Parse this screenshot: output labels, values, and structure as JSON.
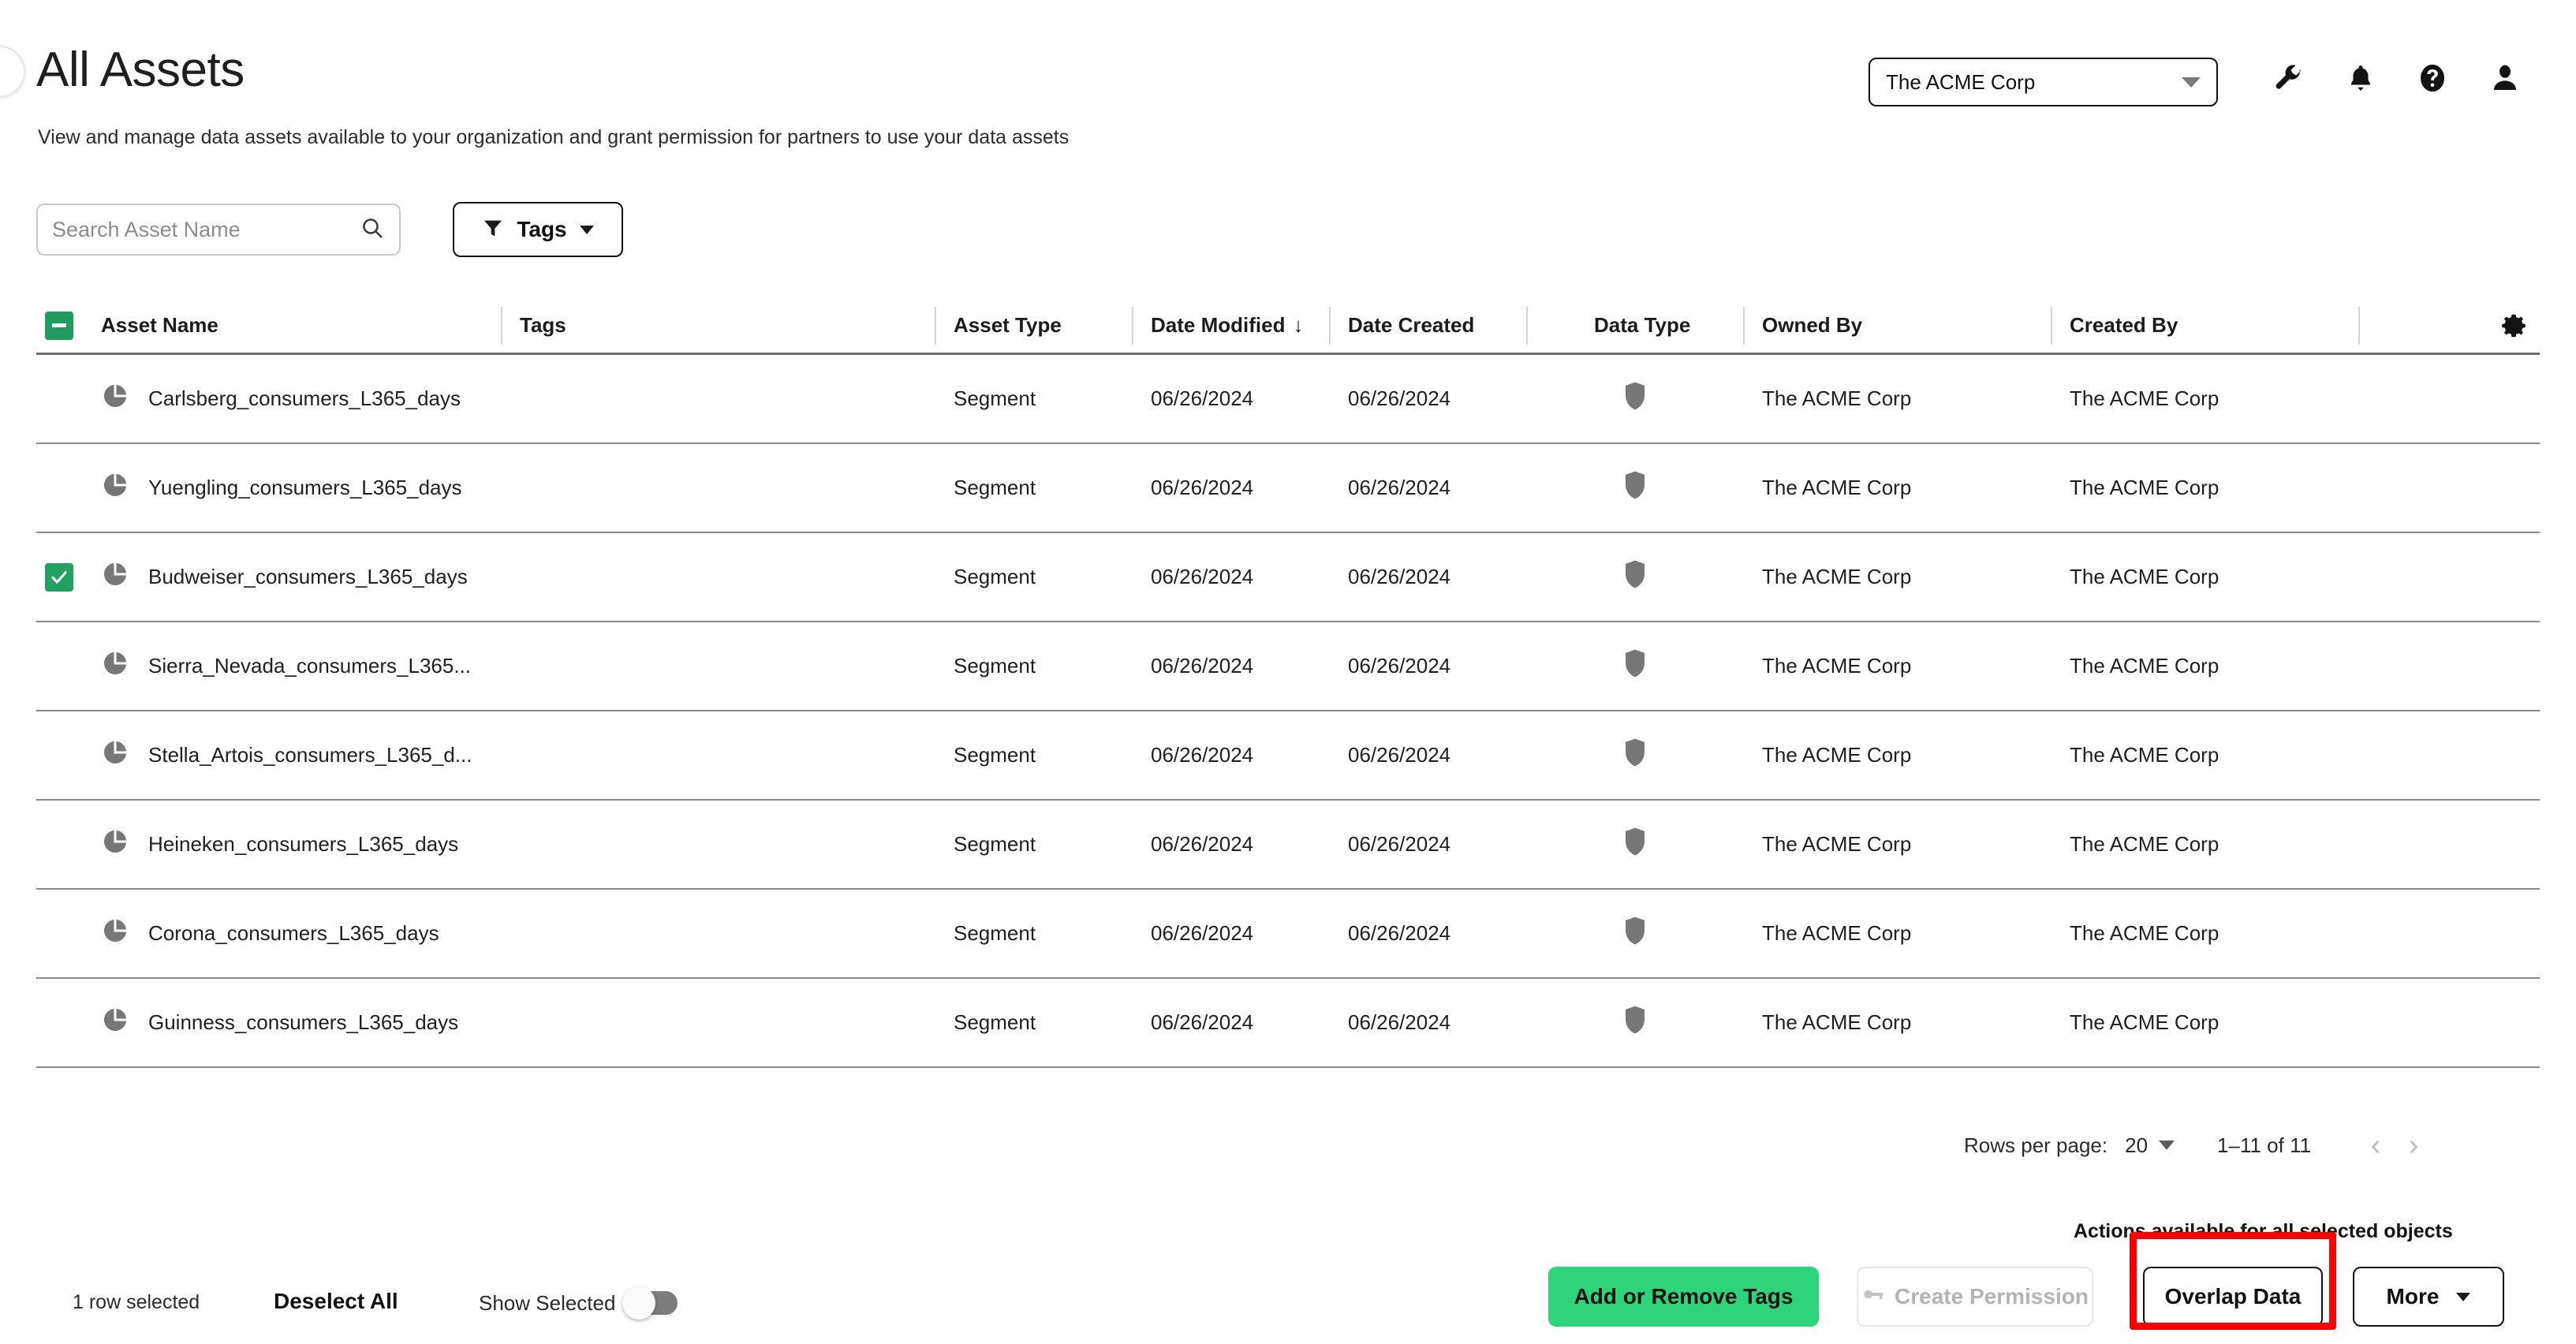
{
  "header": {
    "title": "All Assets",
    "subtitle": "View and manage data assets available to your organization and grant permission for partners to use your data assets",
    "org_selector": {
      "value": "The ACME Corp"
    },
    "icons": [
      "wrench-icon",
      "bell-icon",
      "help-icon",
      "user-icon"
    ]
  },
  "toolbar": {
    "search_placeholder": "Search Asset Name",
    "search_value": "",
    "tags_label": "Tags"
  },
  "table": {
    "columns": [
      {
        "key": "asset_name",
        "label": "Asset Name"
      },
      {
        "key": "tags",
        "label": "Tags"
      },
      {
        "key": "asset_type",
        "label": "Asset Type"
      },
      {
        "key": "date_modified",
        "label": "Date Modified",
        "sort": "desc",
        "sort_glyph": "↓"
      },
      {
        "key": "date_created",
        "label": "Date Created"
      },
      {
        "key": "data_type",
        "label": "Data Type"
      },
      {
        "key": "owned_by",
        "label": "Owned By"
      },
      {
        "key": "created_by",
        "label": "Created By"
      }
    ],
    "select_all_state": "indeterminate",
    "settings_icon": "gear-icon",
    "rows": [
      {
        "selected": false,
        "asset_name": "Carlsberg_consumers_L365_days",
        "tags": "",
        "asset_type": "Segment",
        "date_modified": "06/26/2024",
        "date_created": "06/26/2024",
        "data_type": "shield-icon",
        "owned_by": "The ACME Corp",
        "created_by": "The ACME Corp"
      },
      {
        "selected": false,
        "asset_name": "Yuengling_consumers_L365_days",
        "tags": "",
        "asset_type": "Segment",
        "date_modified": "06/26/2024",
        "date_created": "06/26/2024",
        "data_type": "shield-icon",
        "owned_by": "The ACME Corp",
        "created_by": "The ACME Corp"
      },
      {
        "selected": true,
        "asset_name": "Budweiser_consumers_L365_days",
        "tags": "",
        "asset_type": "Segment",
        "date_modified": "06/26/2024",
        "date_created": "06/26/2024",
        "data_type": "shield-icon",
        "owned_by": "The ACME Corp",
        "created_by": "The ACME Corp"
      },
      {
        "selected": false,
        "asset_name": "Sierra_Nevada_consumers_L365...",
        "tags": "",
        "asset_type": "Segment",
        "date_modified": "06/26/2024",
        "date_created": "06/26/2024",
        "data_type": "shield-icon",
        "owned_by": "The ACME Corp",
        "created_by": "The ACME Corp"
      },
      {
        "selected": false,
        "asset_name": "Stella_Artois_consumers_L365_d...",
        "tags": "",
        "asset_type": "Segment",
        "date_modified": "06/26/2024",
        "date_created": "06/26/2024",
        "data_type": "shield-icon",
        "owned_by": "The ACME Corp",
        "created_by": "The ACME Corp"
      },
      {
        "selected": false,
        "asset_name": "Heineken_consumers_L365_days",
        "tags": "",
        "asset_type": "Segment",
        "date_modified": "06/26/2024",
        "date_created": "06/26/2024",
        "data_type": "shield-icon",
        "owned_by": "The ACME Corp",
        "created_by": "The ACME Corp"
      },
      {
        "selected": false,
        "asset_name": "Corona_consumers_L365_days",
        "tags": "",
        "asset_type": "Segment",
        "date_modified": "06/26/2024",
        "date_created": "06/26/2024",
        "data_type": "shield-icon",
        "owned_by": "The ACME Corp",
        "created_by": "The ACME Corp"
      },
      {
        "selected": false,
        "asset_name": "Guinness_consumers_L365_days",
        "tags": "",
        "asset_type": "Segment",
        "date_modified": "06/26/2024",
        "date_created": "06/26/2024",
        "data_type": "shield-icon",
        "owned_by": "The ACME Corp",
        "created_by": "The ACME Corp"
      }
    ]
  },
  "pagination": {
    "rows_per_page_label": "Rows per page:",
    "rows_per_page_value": "20",
    "range_label": "1–11 of 11",
    "prev_glyph": "‹",
    "next_glyph": "›"
  },
  "bottom_bar": {
    "note": "Actions available for all selected objects",
    "selected_count": "1 row selected",
    "deselect_all": "Deselect All",
    "show_selected_label": "Show Selected",
    "show_selected_on": false,
    "add_remove_tags": "Add or Remove Tags",
    "create_permission": "Create Permission",
    "create_permission_disabled": true,
    "overlap_data": "Overlap Data",
    "more": "More"
  },
  "colors": {
    "accent_green": "#2ed47a",
    "checkbox_green": "#22a161",
    "highlight_red": "#ff0000",
    "icon_gray": "#7a7a7a"
  }
}
